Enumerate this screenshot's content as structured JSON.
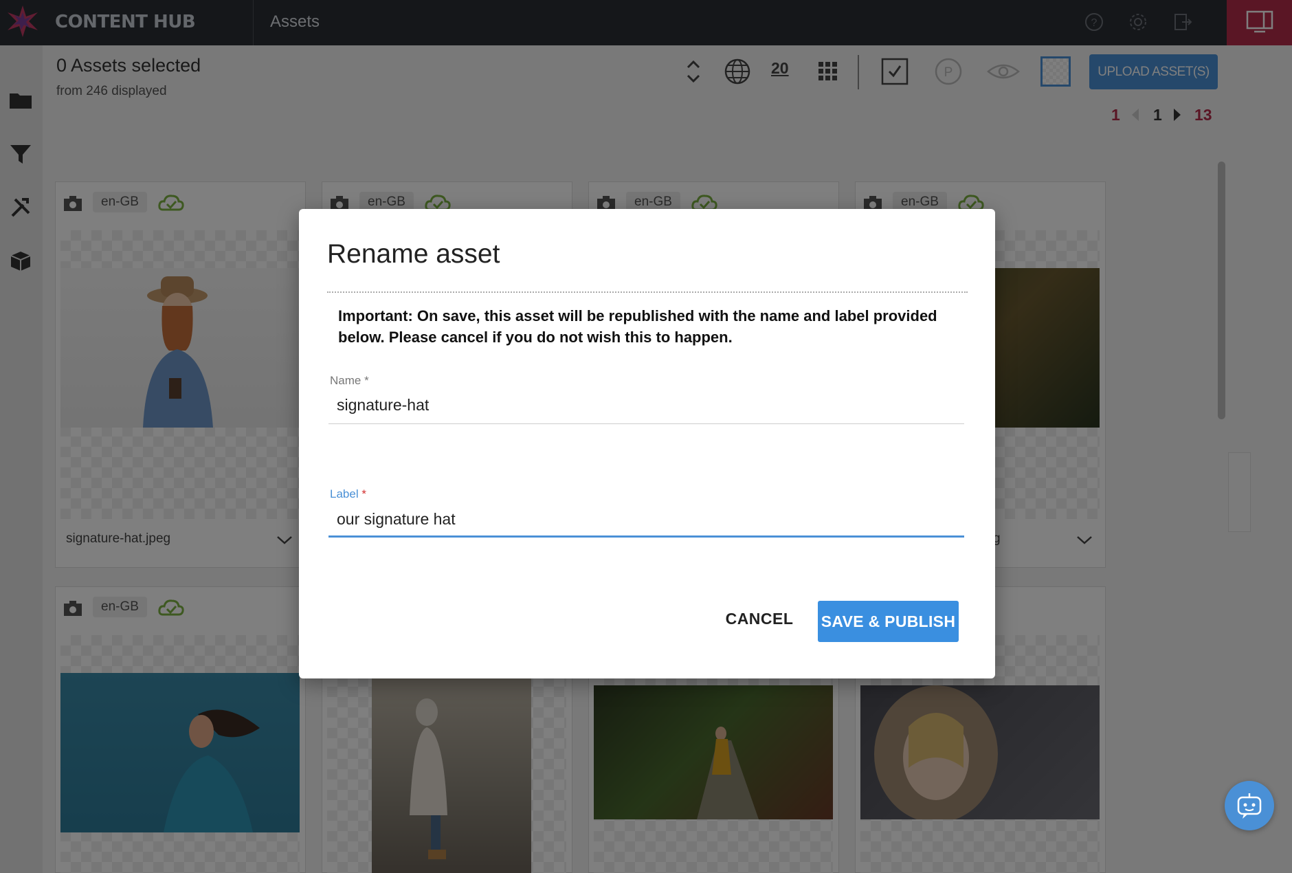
{
  "header": {
    "brand": "CONTENT HUB",
    "section_title": "Assets",
    "icons": [
      "help-icon",
      "gear-icon",
      "logout-icon",
      "panel-toggle-icon"
    ]
  },
  "left_rail": {
    "icons": [
      "folder-icon",
      "filter-icon",
      "tools-icon",
      "package-icon"
    ]
  },
  "toolbar": {
    "selected_title": "0 Assets selected",
    "selected_subtitle": "from 246 displayed",
    "page_size": "20",
    "upload_label": "UPLOAD ASSET(S)",
    "pagination": {
      "first": "1",
      "current": "1",
      "last": "13"
    }
  },
  "cards": [
    {
      "locale": "en-GB",
      "name": "signature-hat.jpeg"
    },
    {
      "locale": "en-GB",
      "name": ""
    },
    {
      "locale": "en-GB",
      "name": ""
    },
    {
      "locale": "en-GB",
      "name": "g"
    },
    {
      "locale": "en-GB",
      "name": ""
    },
    {
      "locale": "",
      "name": ""
    },
    {
      "locale": "",
      "name": ""
    },
    {
      "locale": "",
      "name": ""
    }
  ],
  "dialog": {
    "title": "Rename asset",
    "message": "Important: On save, this asset will be republished with the name and label provided below. Please cancel if you do not wish this to happen.",
    "name_label": "Name",
    "name_value": "signature-hat",
    "label_label": "Label",
    "label_value": "our signature hat",
    "required_mark": "*",
    "cancel_label": "CANCEL",
    "save_label": "SAVE & PUBLISH"
  },
  "colors": {
    "topbar": "#2a2e34",
    "accent_blue": "#4a90d6",
    "accent_red": "#b52c4b",
    "pagination_red": "#b52c4b",
    "cloud_green": "#7cb342"
  }
}
